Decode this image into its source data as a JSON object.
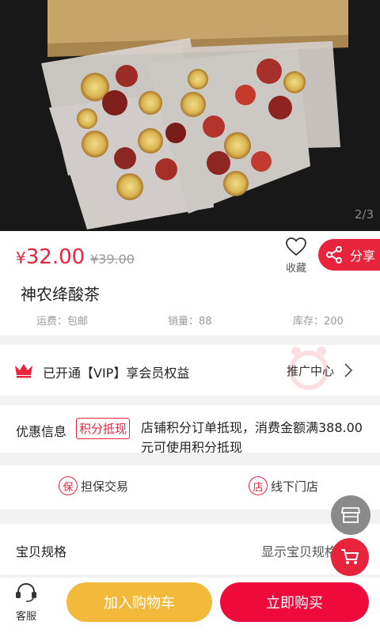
{
  "hero": {
    "image_counter": "2/3"
  },
  "product": {
    "currency": "¥",
    "price": "32.00",
    "original_price": "¥39.00",
    "favorite_label": "收藏",
    "share_label": "分享",
    "title": "神农绛酸茶",
    "shipping": "运费：包邮",
    "sales": "销量：88",
    "stock": "库存：200"
  },
  "vip": {
    "text": "已开通【VIP】享会员权益",
    "promo_center": "推广中心"
  },
  "discount": {
    "label": "优惠信息",
    "badge": "积分抵现",
    "description": "店铺积分订单抵现，消费金额满388.00元可使用积分抵现"
  },
  "guarantees": [
    {
      "icon_char": "保",
      "label": "担保交易"
    },
    {
      "icon_char": "店",
      "label": "线下门店"
    }
  ],
  "specs": {
    "label": "宝贝规格",
    "show_label": "显示宝贝规格"
  },
  "bottom_bar": {
    "service_label": "客服",
    "add_to_cart": "加入购物车",
    "buy_now": "立即购买"
  },
  "colors": {
    "accent": "#e8243c",
    "cart_button": "#f2b93b",
    "buy_button": "#ee0a3a"
  },
  "icons": [
    "heart-icon",
    "share-icon",
    "crown-icon",
    "chevron-right-icon",
    "store-icon",
    "cart-icon",
    "headset-icon"
  ]
}
